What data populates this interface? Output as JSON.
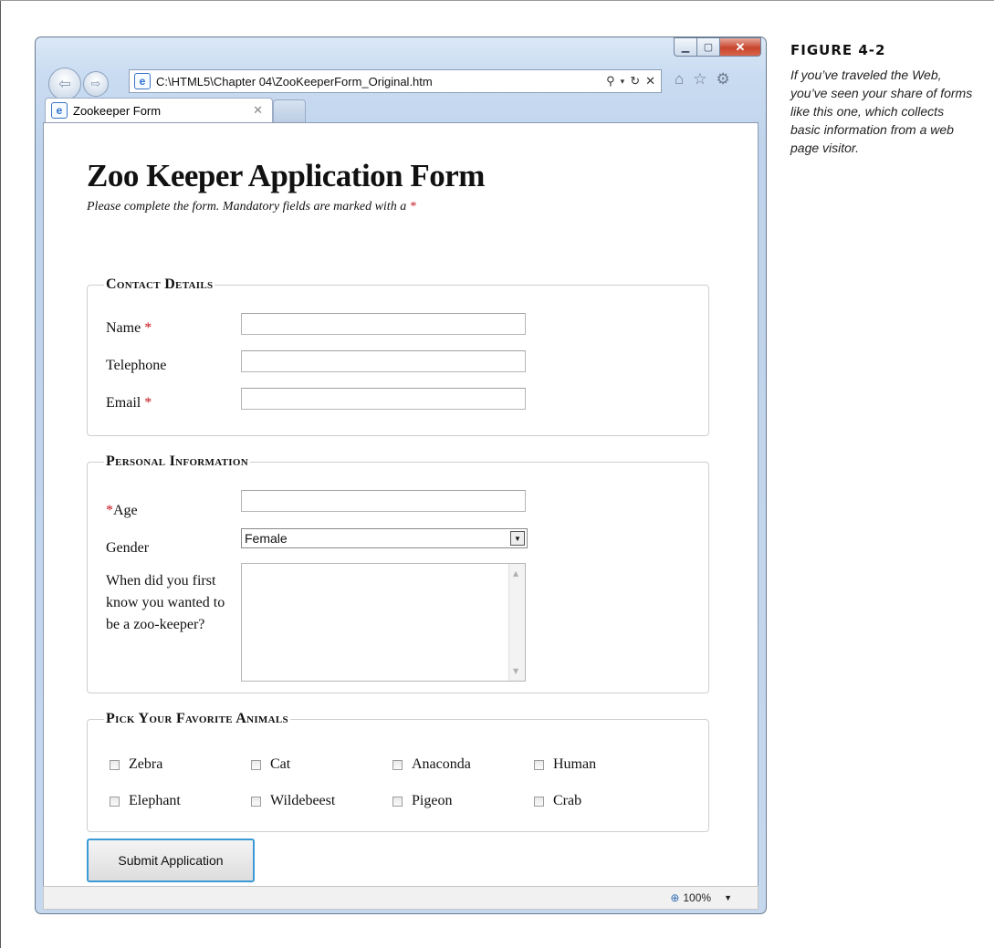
{
  "figure": {
    "number": "FIGURE 4-2",
    "caption": "If you’ve traveled the Web, you’ve seen your share of forms like this one, which collects basic information from a web page visitor."
  },
  "browser": {
    "address": "C:\\HTML5\\Chapter 04\\ZooKeeperForm_Original.htm",
    "tab_title": "Zookeeper Form",
    "zoom": "100%",
    "icons": [
      "back-icon",
      "forward-icon",
      "ie-icon",
      "search-icon",
      "refresh-icon",
      "stop-icon",
      "home-icon",
      "favorites-icon",
      "gear-icon",
      "zoom-icon"
    ]
  },
  "page": {
    "title": "Zoo Keeper Application Form",
    "subtitle": "Please complete the form. Mandatory fields are marked with a",
    "required_mark": "*"
  },
  "contact": {
    "legend": "Contact Details",
    "name_label": "Name",
    "telephone_label": "Telephone",
    "email_label": "Email",
    "name_value": "",
    "telephone_value": "",
    "email_value": ""
  },
  "personal": {
    "legend": "Personal Information",
    "age_label": "Age",
    "gender_label": "Gender",
    "gender_value": "Female",
    "question_label": "When did you first know you wanted to be a zoo-keeper?",
    "age_value": "",
    "question_value": ""
  },
  "animals": {
    "legend": "Pick Your Favorite Animals",
    "items": [
      "Zebra",
      "Cat",
      "Anaconda",
      "Human",
      "Elephant",
      "Wildebeest",
      "Pigeon",
      "Crab"
    ]
  },
  "submit_label": "Submit Application"
}
